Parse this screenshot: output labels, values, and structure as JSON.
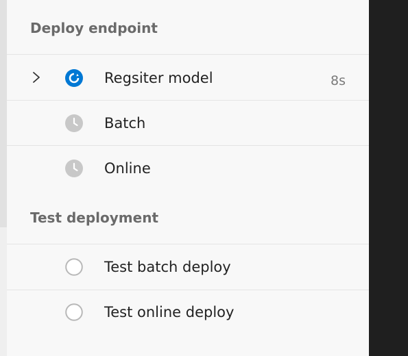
{
  "stages": [
    {
      "title": "Deploy endpoint",
      "jobs": [
        {
          "name": "Regsiter model",
          "duration": "8s",
          "status": "running",
          "status_icon": "running-icon",
          "expandable": true
        },
        {
          "name": "Batch",
          "status": "queued",
          "status_icon": "clock-icon"
        },
        {
          "name": "Online",
          "status": "queued",
          "status_icon": "clock-icon"
        }
      ]
    },
    {
      "title": "Test deployment",
      "jobs": [
        {
          "name": "Test batch deploy",
          "status": "not-started",
          "status_icon": "empty-circle-icon"
        },
        {
          "name": "Test online deploy",
          "status": "not-started",
          "status_icon": "empty-circle-icon"
        }
      ]
    }
  ],
  "colors": {
    "running_blue": "#0078d4",
    "queued_gray": "#c8c8c8",
    "pending_outline": "#b8b8b8",
    "header_text": "#6a6a6a",
    "row_text": "#222222"
  }
}
